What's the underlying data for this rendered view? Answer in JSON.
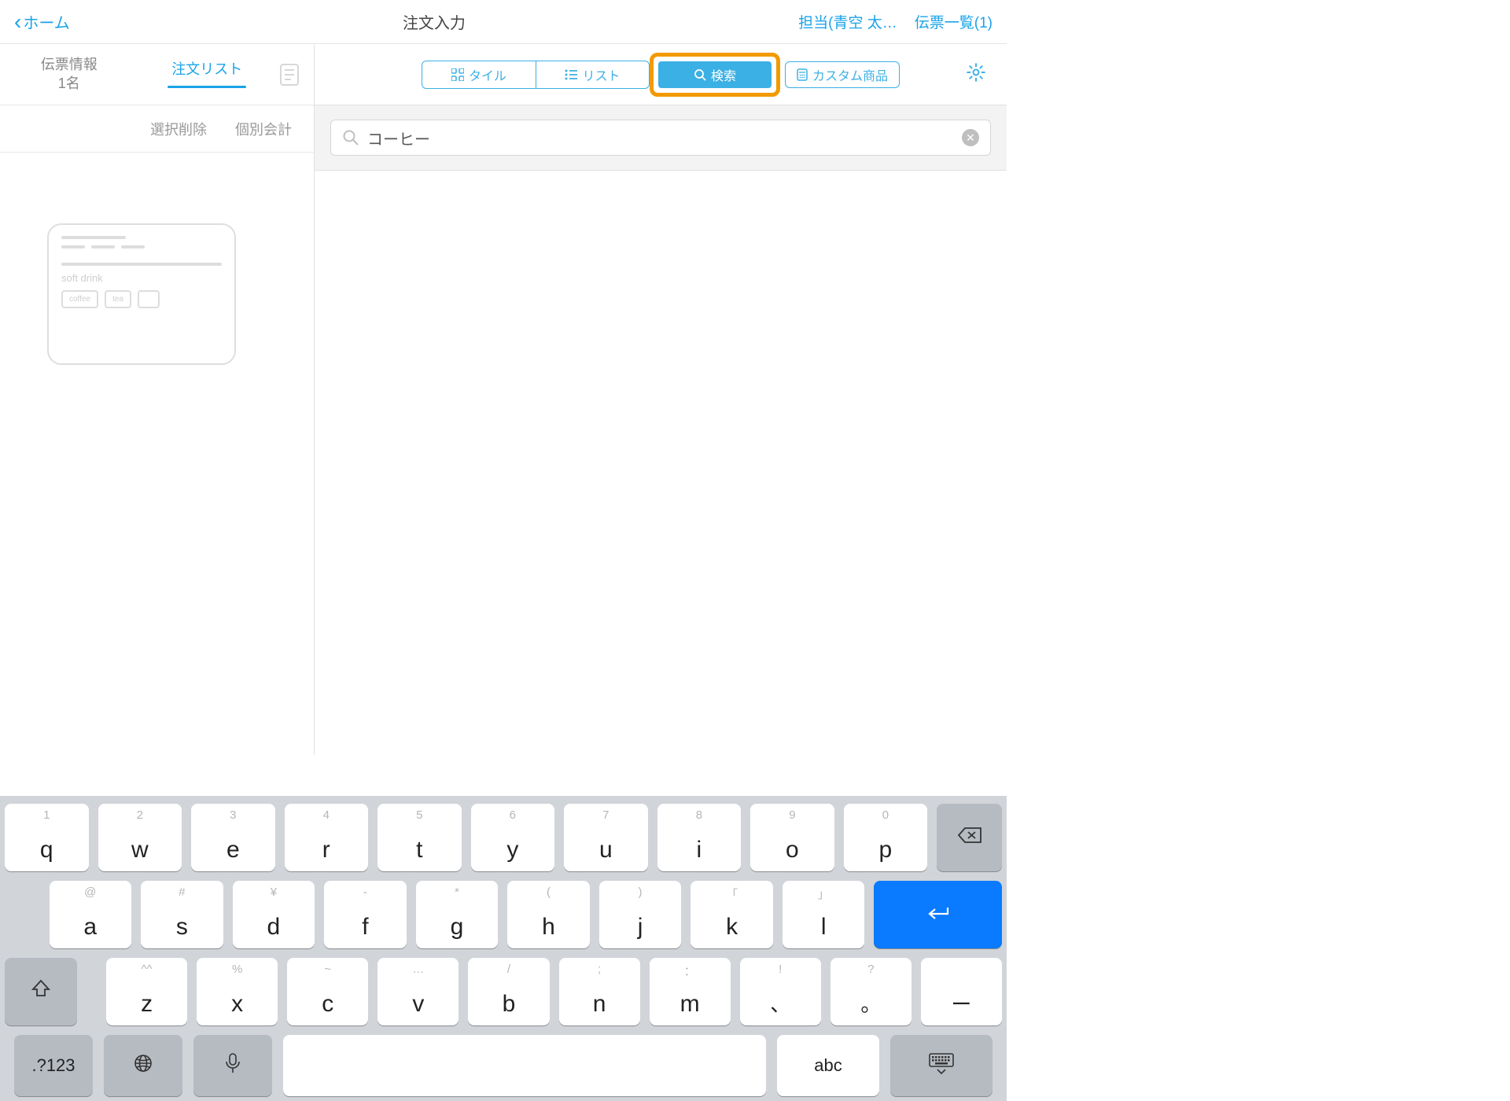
{
  "nav": {
    "back": "ホーム",
    "title": "注文入力",
    "person": "担当(青空 太…",
    "slips": "伝票一覧(1)"
  },
  "left": {
    "tab_info_line1": "伝票情報",
    "tab_info_line2": "1名",
    "tab_orders": "注文リスト",
    "action_delete": "選択削除",
    "action_split": "個別会計",
    "ghost_label": "soft drink",
    "ghost_chip1": "coffee",
    "ghost_chip2": "tea"
  },
  "right": {
    "seg_tile": "タイル",
    "seg_list": "リスト",
    "seg_search": "検索",
    "custom_item": "カスタム商品",
    "search_value": "コーヒー"
  },
  "kb": {
    "r1": [
      {
        "h": "1",
        "m": "q"
      },
      {
        "h": "2",
        "m": "w"
      },
      {
        "h": "3",
        "m": "e"
      },
      {
        "h": "4",
        "m": "r"
      },
      {
        "h": "5",
        "m": "t"
      },
      {
        "h": "6",
        "m": "y"
      },
      {
        "h": "7",
        "m": "u"
      },
      {
        "h": "8",
        "m": "i"
      },
      {
        "h": "9",
        "m": "o"
      },
      {
        "h": "0",
        "m": "p"
      }
    ],
    "r2": [
      {
        "h": "@",
        "m": "a"
      },
      {
        "h": "#",
        "m": "s"
      },
      {
        "h": "¥",
        "m": "d"
      },
      {
        "h": "-",
        "m": "f"
      },
      {
        "h": "*",
        "m": "g"
      },
      {
        "h": "(",
        "m": "h"
      },
      {
        "h": ")",
        "m": "j"
      },
      {
        "h": "「",
        "m": "k"
      },
      {
        "h": "」",
        "m": "l"
      }
    ],
    "r3": [
      {
        "h": "^^",
        "m": "z"
      },
      {
        "h": "%",
        "m": "x"
      },
      {
        "h": "~",
        "m": "c"
      },
      {
        "h": "…",
        "m": "v"
      },
      {
        "h": "/",
        "m": "b"
      },
      {
        "h": ";",
        "m": "n"
      },
      {
        "h": "：",
        "m": "m"
      }
    ],
    "r3p": [
      {
        "h": "!",
        "m": "、"
      },
      {
        "h": "?",
        "m": "。"
      },
      {
        "m": "ー"
      }
    ],
    "symnum": ".?123",
    "abc": "abc"
  }
}
